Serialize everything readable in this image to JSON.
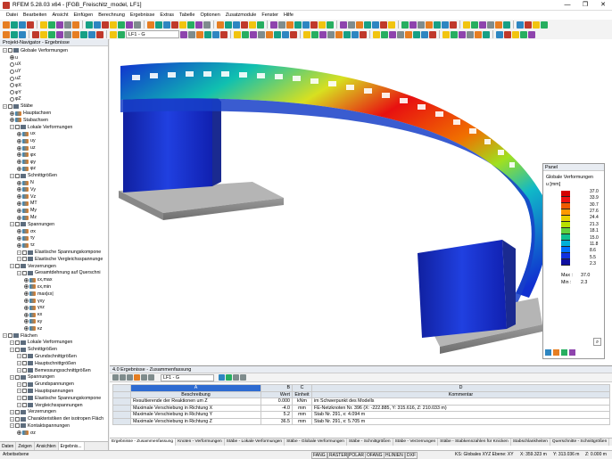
{
  "title": "RFEM 5.28.03 x64 - [FGB_Freischitz_model, LF1]",
  "window_buttons": [
    "—",
    "❐",
    "✕"
  ],
  "menu": [
    "Datei",
    "Bearbeiten",
    "Ansicht",
    "Einfügen",
    "Berechnung",
    "Ergebnisse",
    "Extras",
    "Tabelle",
    "Optionen",
    "Zusatzmodule",
    "Fenster",
    "Hilfe"
  ],
  "toolbar": {
    "loadcase": "LF1 - G"
  },
  "navigator": {
    "title": "Projekt-Navigator - Ergebnisse",
    "items": [
      {
        "label": "Globale Verformungen",
        "level": 0,
        "type": "folder"
      },
      {
        "label": "u",
        "level": 1,
        "type": "radio-on"
      },
      {
        "label": "uX",
        "level": 1,
        "type": "radio"
      },
      {
        "label": "uY",
        "level": 1,
        "type": "radio"
      },
      {
        "label": "uZ",
        "level": 1,
        "type": "radio"
      },
      {
        "label": "φX",
        "level": 1,
        "type": "radio"
      },
      {
        "label": "φY",
        "level": 1,
        "type": "radio"
      },
      {
        "label": "φZ",
        "level": 1,
        "type": "radio"
      },
      {
        "label": "Stäbe",
        "level": 0,
        "type": "folder"
      },
      {
        "label": "Hauptachsen",
        "level": 1,
        "type": "radio-icon"
      },
      {
        "label": "Stabachsen",
        "level": 1,
        "type": "radio-on-icon"
      },
      {
        "label": "Lokale Verformungen",
        "level": 1,
        "type": "folder"
      },
      {
        "label": "ux",
        "level": 2,
        "type": "radio-icon"
      },
      {
        "label": "uy",
        "level": 2,
        "type": "radio-icon"
      },
      {
        "label": "uz",
        "level": 2,
        "type": "radio-icon"
      },
      {
        "label": "φx",
        "level": 2,
        "type": "radio-icon"
      },
      {
        "label": "φy",
        "level": 2,
        "type": "radio-icon"
      },
      {
        "label": "φz",
        "level": 2,
        "type": "radio-icon"
      },
      {
        "label": "Schnittgrößen",
        "level": 1,
        "type": "folder"
      },
      {
        "label": "N",
        "level": 2,
        "type": "radio-icon"
      },
      {
        "label": "Vy",
        "level": 2,
        "type": "radio-icon"
      },
      {
        "label": "Vz",
        "level": 2,
        "type": "radio-icon"
      },
      {
        "label": "MT",
        "level": 2,
        "type": "radio-icon"
      },
      {
        "label": "My",
        "level": 2,
        "type": "radio-on-icon"
      },
      {
        "label": "Mz",
        "level": 2,
        "type": "radio-icon"
      },
      {
        "label": "Spannungen",
        "level": 1,
        "type": "folder"
      },
      {
        "label": "σx",
        "level": 2,
        "type": "radio-icon"
      },
      {
        "label": "τy",
        "level": 2,
        "type": "radio-icon"
      },
      {
        "label": "τz",
        "level": 2,
        "type": "radio-icon"
      },
      {
        "label": "Elastische Spannungskompone",
        "level": 2,
        "type": "folder"
      },
      {
        "label": "Elastische Vergleichsspannunge",
        "level": 2,
        "type": "folder"
      },
      {
        "label": "Verzerrungen",
        "level": 1,
        "type": "folder"
      },
      {
        "label": "Gesamtdehnung auf Querschni",
        "level": 2,
        "type": "folder"
      },
      {
        "label": "εx,max",
        "level": 3,
        "type": "radio-icon"
      },
      {
        "label": "εx,min",
        "level": 3,
        "type": "radio-icon"
      },
      {
        "label": "max|εx|",
        "level": 3,
        "type": "radio-icon"
      },
      {
        "label": "γxy",
        "level": 3,
        "type": "radio-icon"
      },
      {
        "label": "γxz",
        "level": 3,
        "type": "radio-icon"
      },
      {
        "label": "κx",
        "level": 3,
        "type": "radio-icon"
      },
      {
        "label": "κy",
        "level": 3,
        "type": "radio-icon"
      },
      {
        "label": "κz",
        "level": 3,
        "type": "radio-icon"
      },
      {
        "label": "Flächen",
        "level": 0,
        "type": "folder"
      },
      {
        "label": "Lokale Verformungen",
        "level": 1,
        "type": "folder"
      },
      {
        "label": "Schnittgrößen",
        "level": 1,
        "type": "folder"
      },
      {
        "label": "Grundschnittgrößen",
        "level": 2,
        "type": "folder"
      },
      {
        "label": "Hauptschnittgrößen",
        "level": 2,
        "type": "folder"
      },
      {
        "label": "Bemessungsschnittgrößen",
        "level": 2,
        "type": "folder"
      },
      {
        "label": "Spannungen",
        "level": 1,
        "type": "folder"
      },
      {
        "label": "Grundspannungen",
        "level": 2,
        "type": "folder"
      },
      {
        "label": "Hauptspannungen",
        "level": 2,
        "type": "folder"
      },
      {
        "label": "Elastische Spannungskompone",
        "level": 2,
        "type": "folder"
      },
      {
        "label": "Vergleichsspannungen",
        "level": 2,
        "type": "folder"
      },
      {
        "label": "Verzerrungen",
        "level": 1,
        "type": "folder"
      },
      {
        "label": "Charakteristiken der isotropen Fläch",
        "level": 1,
        "type": "folder"
      },
      {
        "label": "Kontaktspannungen",
        "level": 1,
        "type": "folder"
      },
      {
        "label": "σz",
        "level": 2,
        "type": "radio-icon"
      }
    ],
    "tabs": [
      "Daten",
      "Zeigen",
      "Ansichten",
      "Ergebnis..."
    ]
  },
  "panel": {
    "title": "Panel",
    "heading": "Globale Verformungen",
    "unit": "u [mm]",
    "values": [
      "37.0",
      "33.9",
      "30.7",
      "27.6",
      "24.4",
      "21.3",
      "18.1",
      "15.0",
      "11.8",
      "8.6",
      "5.5",
      "2.3"
    ],
    "colors": [
      "#d40000",
      "#ee1010",
      "#f05a00",
      "#ff9900",
      "#e8d000",
      "#b8e000",
      "#60d040",
      "#10c090",
      "#00b0d8",
      "#0070ff",
      "#1030e0",
      "#1010a0"
    ],
    "max_label": "Max :",
    "max_value": "37.0",
    "min_label": "Min :",
    "min_value": "2.3"
  },
  "results": {
    "title": "4.0 Ergebnisse - Zusammenfassung",
    "loadcase": "LF1 - G",
    "col_letters": [
      "A",
      "B",
      "C",
      "D"
    ],
    "col_headers": [
      "Beschreibung",
      "Wert",
      "Einheit",
      "Kommentar"
    ],
    "rows": [
      {
        "desc": "Resultierende der Reaktionen um Z",
        "value": "0.000",
        "unit": "kNm",
        "comment": "im Schwerpunkt des Modells"
      },
      {
        "desc": "Maximale Verschiebung in Richtung X",
        "value": "-4.0",
        "unit": "mm",
        "comment": "FE-Netzknoten Nr. 396 (X: -222.885, Y: 315.616, Z: 210.033 m)"
      },
      {
        "desc": "Maximale Verschiebung in Richtung Y",
        "value": "5.2",
        "unit": "mm",
        "comment": "Stab Nr. 291, x: 4.094 m"
      },
      {
        "desc": "Maximale Verschiebung in Richtung Z",
        "value": "36.5",
        "unit": "mm",
        "comment": "Stab Nr. 291, x: 5.705 m"
      }
    ],
    "tabs": [
      "Ergebnisse - Zusammenfassung",
      "Knoten - Verformungen",
      "Stäbe - Lokale Verformungen",
      "Stäbe - Globale Verformungen",
      "Stäbe - Schnittgrößen",
      "Stäbe - Verzerrungen",
      "Stäbe - Stabkennzahlen für Knicken",
      "Stabschlankheiten",
      "Querschnitte - Schnittgrößen"
    ]
  },
  "status": {
    "left": "Arbeitsebene",
    "toggles": [
      "FANG",
      "RASTER",
      "POLAR",
      "OFANG",
      "HLINIEN",
      "DXF"
    ],
    "coords_sys": "KS: Globales XYZ Ebene: XY",
    "x": "X: 359.323 m",
    "y": "Y: 313.036 m",
    "z": "Z: 0.000 m"
  }
}
